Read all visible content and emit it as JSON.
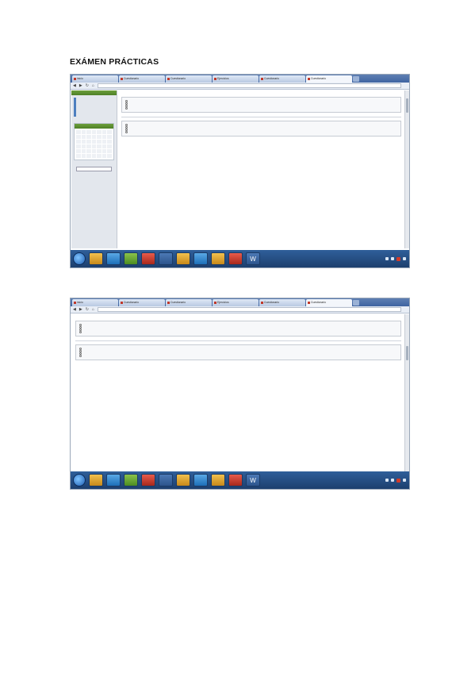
{
  "document": {
    "title": "EXÁMEN PRÁCTICAS"
  },
  "screenshot1": {
    "tabs": [
      "inicio",
      "Cuestionario",
      "Cuestionario",
      "Ejercicios",
      "Cuestionario",
      "Cuestionario"
    ],
    "url": "",
    "header_left": "",
    "header_right": "",
    "info_lines": [
      "",
      "",
      ""
    ],
    "completed": "",
    "time": "",
    "question1": {
      "title": "",
      "text": "",
      "options": [
        "",
        "",
        "",
        ""
      ],
      "score": ""
    },
    "question2": {
      "text": "",
      "options": [
        "",
        "",
        "",
        ""
      ],
      "score": ""
    }
  },
  "screenshot2": {
    "tabs": [
      "inicio",
      "Cuestionario",
      "Cuestionario",
      "Ejercicios",
      "Cuestionario",
      "Cuestionario"
    ],
    "url": "",
    "question1": {
      "text": "",
      "options": [
        "",
        "",
        "",
        ""
      ],
      "score": ""
    },
    "question2": {
      "text": "",
      "code": [
        "",
        "",
        "",
        ""
      ],
      "prompt": "",
      "options": [
        "",
        "",
        "",
        ""
      ],
      "score": ""
    }
  },
  "colors": {
    "taskbar": "#1d3f6e",
    "accent": "#2a55b8",
    "sidebar_green": "#4f8127"
  },
  "icons": [
    "start-orb-icon",
    "folder-icon",
    "ie-icon",
    "chrome-icon",
    "media-icon",
    "app-icon",
    "word-icon"
  ]
}
